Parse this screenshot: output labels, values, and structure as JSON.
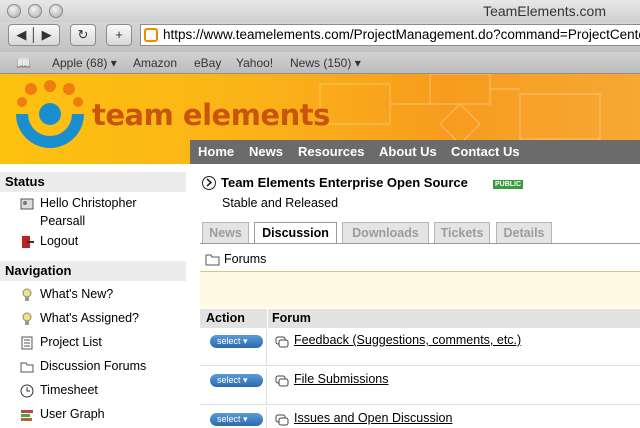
{
  "browser": {
    "window_title": "TeamElements.com",
    "url": "https://www.teamelements.com/ProjectManagement.do?command=ProjectCenter",
    "bookmarks": [
      "Apple (68) ▾",
      "Amazon",
      "eBay",
      "Yahoo!",
      "News (150) ▾"
    ]
  },
  "site": {
    "logo_text": "team elements",
    "nav": [
      "Home",
      "News",
      "Resources",
      "About Us",
      "Contact Us"
    ]
  },
  "sidebar": {
    "status_heading": "Status",
    "greeting_line1": "Hello Christopher",
    "greeting_line2": "Pearsall",
    "logout": "Logout",
    "nav_heading": "Navigation",
    "items": [
      "What's New?",
      "What's Assigned?",
      "Project List",
      "Discussion Forums",
      "Timesheet",
      "User Graph"
    ]
  },
  "project": {
    "title": "Team Elements Enterprise Open Source",
    "badge": "PUBLIC",
    "subtitle": "Stable and Released",
    "tabs": [
      "News",
      "Discussion",
      "Downloads",
      "Tickets",
      "Details"
    ],
    "active_tab": "Discussion",
    "section": "Forums",
    "columns": [
      "Action",
      "Forum"
    ],
    "select_label": "select ▾",
    "forums": [
      "Feedback (Suggestions, comments, etc.)",
      "File Submissions",
      "Issues and Open Discussion"
    ]
  },
  "colors": {
    "banner": "#fbb318",
    "logo_text": "#c8540e",
    "navbar": "#6b6b6b",
    "select_button": "#2b6aad",
    "public_badge": "#3a9b3a"
  }
}
